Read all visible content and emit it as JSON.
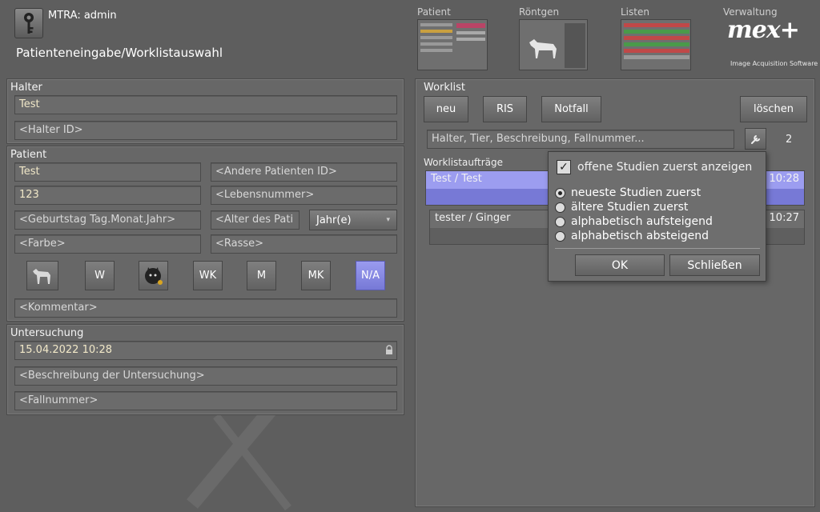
{
  "header": {
    "user": "MTRA: admin",
    "title": "Patienteneingabe/Worklistauswahl",
    "nav": [
      {
        "label": "Patient"
      },
      {
        "label": "Röntgen"
      },
      {
        "label": "Listen"
      },
      {
        "label": "Verwaltung"
      }
    ],
    "logo": "mex+",
    "logo_sub": "Image Acquisition Software"
  },
  "halter": {
    "title": "Halter",
    "name_value": "Test",
    "id_placeholder": "<Halter ID>"
  },
  "patient": {
    "title": "Patient",
    "name_value": "Test",
    "other_id_placeholder": "<Andere Patienten ID>",
    "number_value": "123",
    "lebensnummer_placeholder": "<Lebensnummer>",
    "birthday_placeholder": "<Geburtstag Tag.Monat.Jahr>",
    "age_placeholder": "<Alter des Pati",
    "age_unit": "Jahr(e)",
    "color_placeholder": "<Farbe>",
    "breed_placeholder": "<Rasse>",
    "sex_buttons": [
      "W",
      "WK",
      "M",
      "MK",
      "N/A"
    ],
    "comment_placeholder": "<Kommentar>"
  },
  "untersuchung": {
    "title": "Untersuchung",
    "datetime_value": "15.04.2022 10:28",
    "description_placeholder": "<Beschreibung der Untersuchung>",
    "case_placeholder": "<Fallnummer>"
  },
  "worklist": {
    "title": "Worklist",
    "buttons": {
      "new": "neu",
      "ris": "RIS",
      "emergency": "Notfall",
      "delete": "löschen"
    },
    "search_placeholder": "Halter, Tier, Beschreibung, Fallnummer...",
    "count": "2",
    "orders_title": "Worklistaufträge",
    "orders": [
      {
        "name": "Test / Test",
        "time": "10:28"
      },
      {
        "name": "tester / Ginger",
        "time": "10:27"
      }
    ]
  },
  "popup": {
    "checkbox_label": "offene Studien zuerst anzeigen",
    "options": [
      "neueste Studien zuerst",
      "ältere Studien zuerst",
      "alphabetisch aufsteigend",
      "alphabetisch absteigend"
    ],
    "ok": "OK",
    "close": "Schließen"
  }
}
